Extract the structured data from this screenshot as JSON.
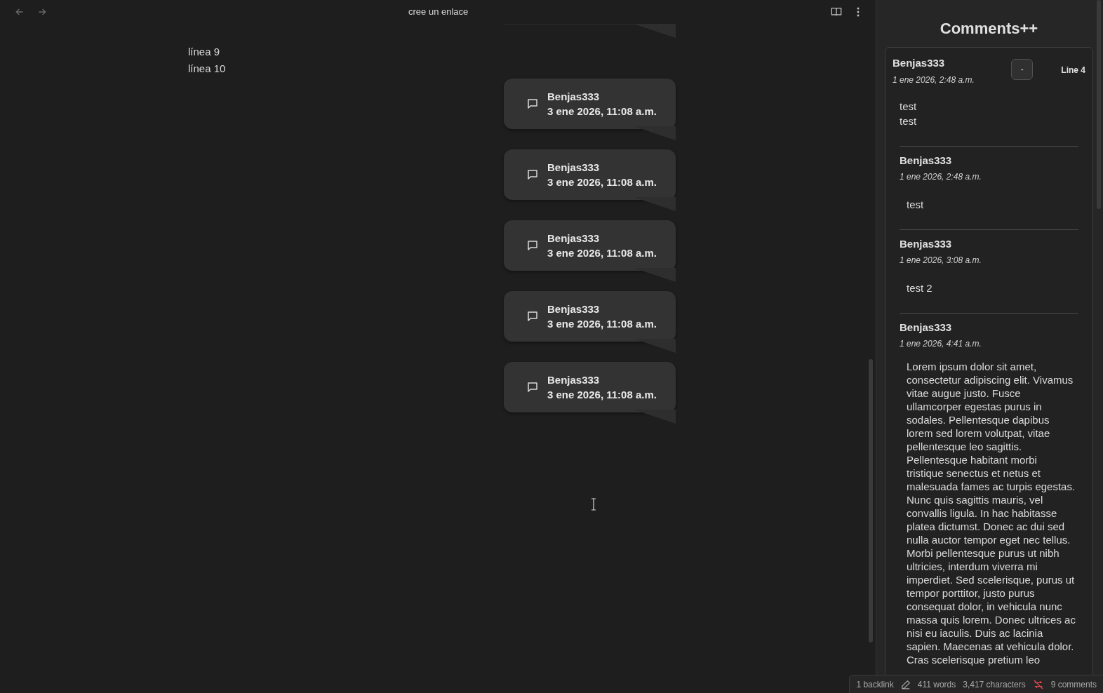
{
  "toolbar": {
    "title": "cree un enlace",
    "back_enabled": false,
    "forward_enabled": false
  },
  "editor": {
    "lines": [
      "línea 9",
      "línea 10"
    ],
    "comment_cards": [
      {
        "author": "Benjas333",
        "date": "3 ene 2026, 11:08 a.m."
      },
      {
        "author": "Benjas333",
        "date": "3 ene 2026, 11:08 a.m."
      },
      {
        "author": "Benjas333",
        "date": "3 ene 2026, 11:08 a.m."
      },
      {
        "author": "Benjas333",
        "date": "3 ene 2026, 11:08 a.m."
      },
      {
        "author": "Benjas333",
        "date": "3 ene 2026, 11:08 a.m."
      }
    ]
  },
  "sidebar": {
    "title": "Comments++",
    "thread": {
      "author": "Benjas333",
      "date": "1 ene 2026, 2:48 a.m.",
      "collapse_button": "-",
      "line": "Line 4",
      "body": "test\ntest",
      "replies": [
        {
          "author": "Benjas333",
          "date": "1 ene 2026, 2:48 a.m.",
          "body": "test"
        },
        {
          "author": "Benjas333",
          "date": "1 ene 2026, 3:08 a.m.",
          "body": "test 2"
        },
        {
          "author": "Benjas333",
          "date": "1 ene 2026, 4:41 a.m.",
          "body": "Lorem ipsum dolor sit amet, consectetur adipiscing elit. Vivamus vitae augue justo. Fusce ullamcorper egestas purus in sodales. Pellentesque dapibus lorem sed lorem volutpat, vitae pellentesque leo sagittis. Pellentesque habitant morbi tristique senectus et netus et malesuada fames ac turpis egestas. Nunc quis sagittis mauris, vel convallis ligula. In hac habitasse platea dictumst. Donec ac dui sed nulla auctor tempor eget nec tellus. Morbi pellentesque purus ut nibh ultricies, interdum viverra mi imperdiet. Sed scelerisque, purus ut tempor porttitor, justo purus consequat dolor, in vehicula nunc massa quis lorem. Donec ultrices ac nisi eu iaculis. Duis ac lacinia sapien. Maecenas at vehicula dolor. Cras scelerisque pretium leo"
        }
      ]
    }
  },
  "status_bar": {
    "backlinks": "1 backlink",
    "words": "411 words",
    "characters": "3,417 characters",
    "sync_off": true,
    "comments": "9 comments"
  }
}
